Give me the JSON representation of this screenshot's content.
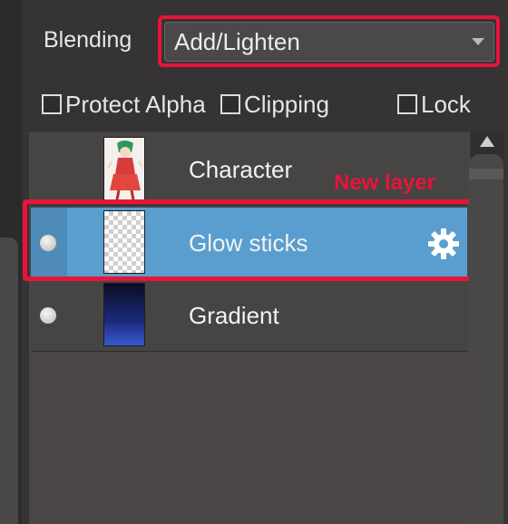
{
  "blending": {
    "label": "Blending",
    "selected": "Add/Lighten"
  },
  "options": {
    "protect_alpha": "Protect Alpha",
    "clipping": "Clipping",
    "lock": "Lock"
  },
  "layers": [
    {
      "name": "Character",
      "visible": false,
      "selected": false
    },
    {
      "name": "Glow sticks",
      "visible": true,
      "selected": true
    },
    {
      "name": "Gradient",
      "visible": true,
      "selected": false
    }
  ],
  "annotations": {
    "new_layer": "New layer"
  },
  "colors": {
    "highlight": "#e8143a",
    "selected_row": "#5a9ecf",
    "panel_bg": "#4a4646"
  }
}
